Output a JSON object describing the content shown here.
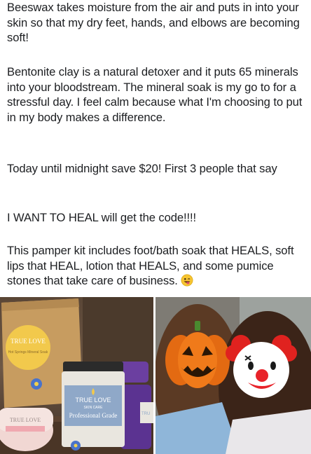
{
  "post": {
    "paragraphs": [
      "Beeswax takes moisture from the air and puts in into your skin so that my dry feet, hands, and elbows are becoming soft!",
      "Bentonite clay is a natural detoxer and it puts 65 minerals into your bloodstream. The mineral soak is my go to for a stressful day. I feel calm because what I'm choosing to put in my body makes a difference.",
      "Today until midnight save $20! First 3 people that say",
      "I WANT TO HEAL will get the code!!!!",
      "This pamper kit includes foot/bath soak that HEALS, soft lips that HEAL, lotion that HEALS, and some pumice stones that take care of business."
    ],
    "trailing_emoji": "grinning-face-with-tongue-icon"
  },
  "photos": {
    "left": {
      "pouch_brand": "TRUE LOVE",
      "pouch_product": "Hot Springs Mineral Soak",
      "jar_brand": "TRUE LOVE",
      "jar_sub": "SKIN CARE",
      "jar_product": "Professional Grade",
      "tin_brand": "TRUE LOVE",
      "side_label": "TRU"
    },
    "right": {
      "overlay_left": "jack-o-lantern-icon",
      "overlay_right": "clown-face-icon"
    }
  },
  "colors": {
    "text": "#1c1e21",
    "pouch_label": "#f2c94c",
    "jar_lid": "#2b2b2b",
    "jar_label": "#8fa8c8",
    "pumice": "#6b3fa0",
    "pumpkin": "#f07a1a",
    "clown_nose": "#e8232a"
  }
}
